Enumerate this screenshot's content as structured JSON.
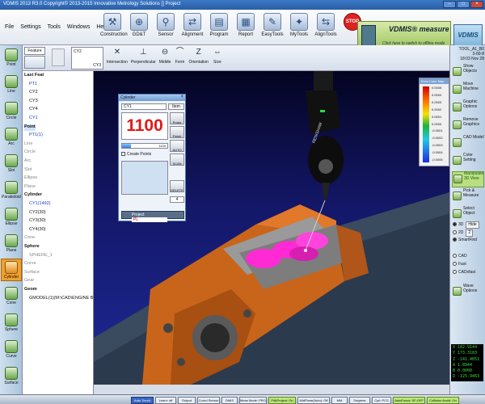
{
  "window": {
    "title": "VDMIS 2013 R3.0  Copyright© 2013-2015 Innovative Metrology Solutions [] Project"
  },
  "menu": [
    "File",
    "Settings",
    "Tools",
    "Windows",
    "Help"
  ],
  "main_tools": [
    {
      "label": "Construction",
      "icon": "construction-icon"
    },
    {
      "label": "GD&T",
      "icon": "gdt-icon"
    },
    {
      "label": "Sensor",
      "icon": "sensor-icon"
    },
    {
      "label": "Alignment",
      "icon": "alignment-icon"
    },
    {
      "label": "Program",
      "icon": "program-icon"
    },
    {
      "label": "Report",
      "icon": "report-icon"
    },
    {
      "label": "EasyTools",
      "icon": "easytools-icon"
    },
    {
      "label": "MyTools",
      "icon": "mytools-icon"
    },
    {
      "label": "AlignTools",
      "icon": "aligntools-icon"
    },
    {
      "label": "STOP",
      "icon": "stop-icon"
    }
  ],
  "measure_panel": {
    "title": "VDMIS® measure",
    "subtitle": "Click here to switch to offline mode"
  },
  "logo_text": "VDMIS",
  "subbar": {
    "feature_tab": "Feature",
    "cyl_label": "CY2",
    "cyl_sub": "CY3",
    "tools": [
      "Intersection",
      "Perpendicular",
      "Middle",
      "Form",
      "Orientation",
      "Size"
    ]
  },
  "left_features": [
    "Point",
    "Line",
    "Circle",
    "Arc",
    "Slot",
    "Paraboloid",
    "Ellipse",
    "Plane",
    "Cylinder",
    "Cone",
    "Sphere",
    "Curve",
    "Surface"
  ],
  "active_feature": "Cylinder",
  "tree": [
    {
      "text": "Last Feat",
      "cls": "hdr",
      "indent": 2
    },
    {
      "text": "PT1",
      "cls": "blue",
      "indent": 8
    },
    {
      "text": "CY2",
      "cls": "",
      "indent": 8
    },
    {
      "text": "CY3",
      "cls": "",
      "indent": 8
    },
    {
      "text": "CY4",
      "cls": "",
      "indent": 8
    },
    {
      "text": "CY1",
      "cls": "blue",
      "indent": 8
    },
    {
      "text": "Point",
      "cls": "hdr sel",
      "indent": 2
    },
    {
      "text": "PT1(1)",
      "cls": "blue",
      "indent": 8
    },
    {
      "text": "Line",
      "cls": "gray",
      "indent": 2
    },
    {
      "text": "Circle",
      "cls": "gray",
      "indent": 2
    },
    {
      "text": "Arc",
      "cls": "gray",
      "indent": 2
    },
    {
      "text": "Slot",
      "cls": "gray",
      "indent": 2
    },
    {
      "text": "Ellipse",
      "cls": "gray",
      "indent": 2
    },
    {
      "text": "Plane",
      "cls": "gray",
      "indent": 2
    },
    {
      "text": "Cylinder",
      "cls": "hdr",
      "indent": 2
    },
    {
      "text": "CY1(1492)",
      "cls": "blue",
      "indent": 8
    },
    {
      "text": "CY2(30)",
      "cls": "",
      "indent": 8
    },
    {
      "text": "CY3(30)",
      "cls": "",
      "indent": 8
    },
    {
      "text": "CY4(30)",
      "cls": "",
      "indent": 8
    },
    {
      "text": "Cone",
      "cls": "gray",
      "indent": 2
    },
    {
      "text": "Sphere",
      "cls": "hdr",
      "indent": 2
    },
    {
      "text": "SPHERE_1",
      "cls": "gray",
      "indent": 8
    },
    {
      "text": "Curve",
      "cls": "gray",
      "indent": 2
    },
    {
      "text": "Surface",
      "cls": "gray",
      "indent": 2
    },
    {
      "text": "Gear",
      "cls": "gray",
      "indent": 2
    },
    {
      "text": "Geom",
      "cls": "hdr",
      "indent": 2
    },
    {
      "text": "GMODEL(1)(M:\\CAD\\ENGINE BLOCK)",
      "cls": "",
      "indent": 8
    }
  ],
  "feature_panel": {
    "title": "Cylinder",
    "name": "CY1",
    "items_label": "Item",
    "count": "1100",
    "progress_pct": 20,
    "progress_label": "1100",
    "create_points": "Create Points",
    "buttons": [
      "Probe",
      "Finish",
      "AUTO",
      "SCAN",
      "DELETE"
    ],
    "number": "4",
    "project_label": "Project",
    "project_value": "PL"
  },
  "error_color_map": {
    "title": "Error Color Map",
    "values": [
      "0.0005",
      "0.0004",
      "0.0003",
      "0.0002",
      "0.0001",
      "0.0000",
      "-0.0001",
      "-0.0002",
      "-0.0003",
      "-0.0004",
      "-0.0005"
    ]
  },
  "probe_text": "RENISHAW",
  "right_info": [
    "TOOL_A1_B0",
    "3-60-8",
    "18:03 Nov 28"
  ],
  "right_buttons": [
    {
      "label": "Show Objects",
      "active": false
    },
    {
      "label": "Move Machine",
      "active": false
    },
    {
      "label": "Graphic Options",
      "active": false
    },
    {
      "label": "Remove Graphics",
      "active": false
    },
    {
      "label": "CAD Model",
      "active": false
    },
    {
      "label": "Color Setting",
      "active": false
    },
    {
      "label": "Manipulate 3D View",
      "active": true
    },
    {
      "label": "Pick & Measure",
      "active": false
    },
    {
      "label": "Select Object",
      "active": false
    }
  ],
  "view_options": [
    {
      "label": "3D",
      "on": true
    },
    {
      "label": "2D",
      "on": false
    },
    {
      "label": "SmartFind",
      "on": true
    },
    {
      "label": "CAD",
      "on": false
    },
    {
      "label": "Fast",
      "on": false
    },
    {
      "label": "CADxfast",
      "on": false
    }
  ],
  "hide_label": "Hide",
  "two_d_value": "2",
  "wave_button": "Wave Options",
  "coords": [
    {
      "axis": "X",
      "value": "182.9144"
    },
    {
      "axis": "Y",
      "value": "173.3183"
    },
    {
      "axis": "Z",
      "value": "-141.4051"
    },
    {
      "axis": "A",
      "value": "1.8944"
    },
    {
      "axis": "B",
      "value": "0.0000"
    },
    {
      "axis": "D",
      "value": "-125.9463"
    }
  ],
  "statusbar": [
    {
      "label": "Auto Touch",
      "style": "blu"
    },
    {
      "label": "Learn: off",
      "style": ""
    },
    {
      "label": "Output",
      "style": ""
    },
    {
      "label": "Coord Sensor",
      "style": ""
    },
    {
      "label": "DMIS",
      "style": ""
    },
    {
      "label": "Meas Mode: PROG",
      "style": ""
    },
    {
      "label": "Fit&Project: On",
      "style": "grn"
    },
    {
      "label": "MidPlane(Auto): Off",
      "style": ""
    },
    {
      "label": "MM",
      "style": ""
    },
    {
      "label": "Degrees",
      "style": ""
    },
    {
      "label": "Cyrl: PCS",
      "style": ""
    },
    {
      "label": "AutoFocus: SF:OFF",
      "style": "grn"
    },
    {
      "label": "Collision Avoid: On",
      "style": "grn"
    }
  ],
  "colors": {
    "accent": "#2a5ea5",
    "active_feature": "#f2a12a",
    "part_orange": "#d2691e",
    "bore_magenta": "#ff2ad4",
    "count_red": "#e01818"
  }
}
